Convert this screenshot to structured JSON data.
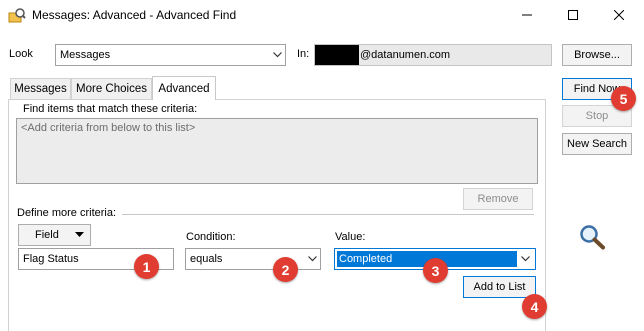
{
  "window": {
    "title": "Messages: Advanced - Advanced Find",
    "minimize_icon": "minimize-icon",
    "maximize_icon": "maximize-icon",
    "close_icon": "close-icon"
  },
  "look": {
    "label": "Look",
    "value": "Messages",
    "in_label": "In:",
    "in_value": "@datanumen.com"
  },
  "buttons": {
    "browse": "Browse...",
    "find_now": "Find Now",
    "stop": "Stop",
    "new_search": "New Search",
    "remove": "Remove",
    "add_to_list": "Add to List"
  },
  "tabs": [
    {
      "label": "Messages",
      "active": false
    },
    {
      "label": "More Choices",
      "active": false
    },
    {
      "label": "Advanced",
      "active": true
    }
  ],
  "criteria": {
    "heading": "Find items that match these criteria:",
    "placeholder": "<Add criteria from below to this list>"
  },
  "define": {
    "heading": "Define more criteria:",
    "field_button": "Field",
    "field_value": "Flag Status",
    "condition_label": "Condition:",
    "condition_value": "equals",
    "value_label": "Value:",
    "value_value": "Completed"
  },
  "badges": [
    "1",
    "2",
    "3",
    "4",
    "5"
  ],
  "colors": {
    "badge": "#e03c31",
    "selection": "#0078d7"
  }
}
